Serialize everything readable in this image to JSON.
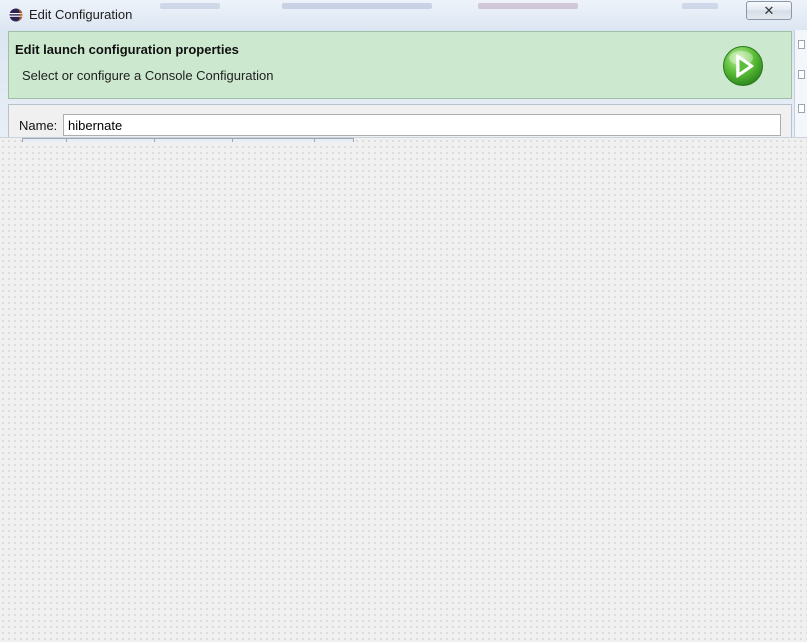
{
  "window": {
    "title": "Edit Configuration",
    "close_symbol": "✕",
    "app_icon": "eclipse-icon"
  },
  "banner": {
    "title": "Edit launch configuration properties",
    "subtitle": "Select or configure a Console Configuration",
    "icon": "run-icon",
    "background": "#cce8cf"
  },
  "form": {
    "name_label": "Name:",
    "name_value": "hibernate"
  },
  "colors": {
    "banner_bg": "#cce8cf",
    "run_icon_green": "#4caf3c",
    "title_bar": "#dce6f2"
  }
}
